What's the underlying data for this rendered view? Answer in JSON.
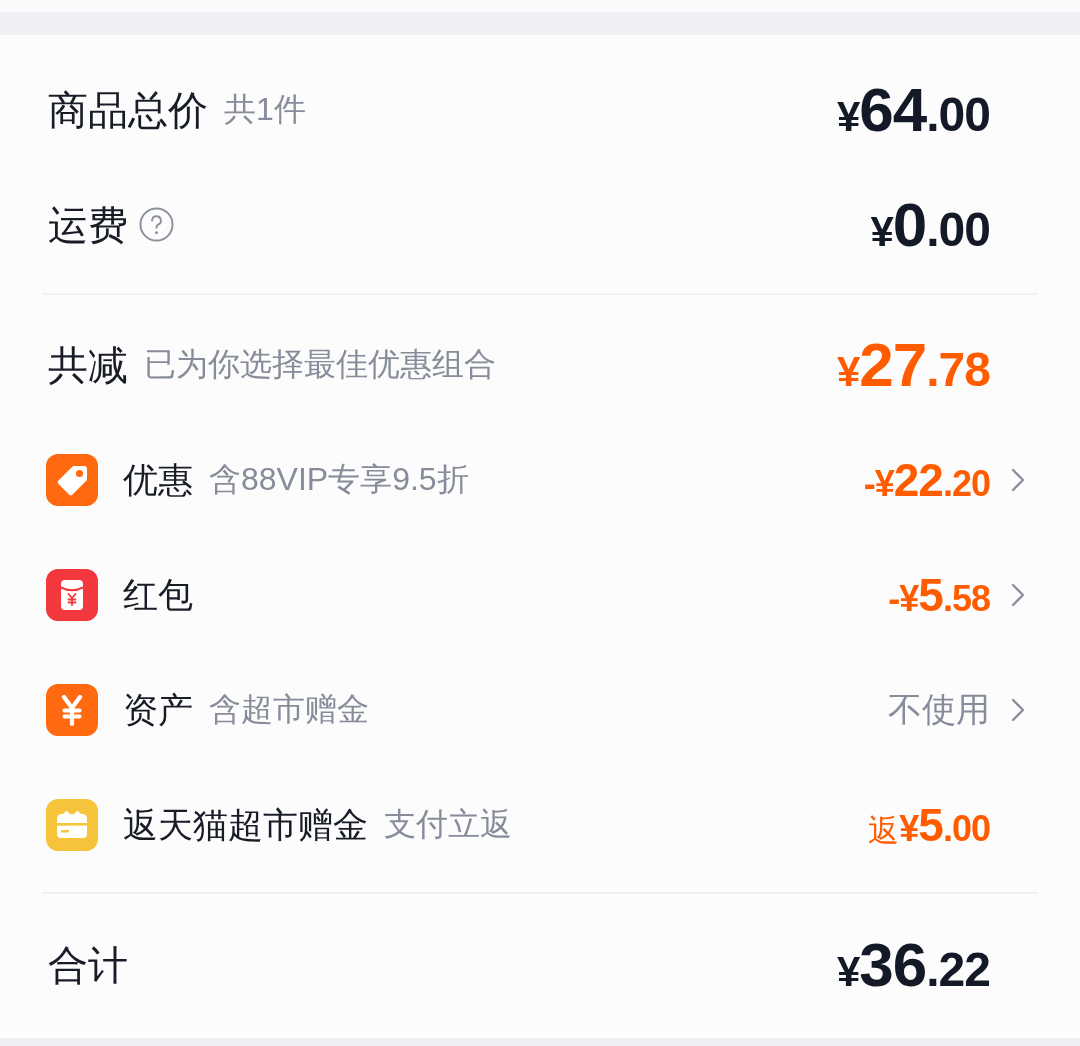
{
  "price_rows": [
    {
      "label": "商品总价",
      "note": "共1件",
      "help": false,
      "amount": "¥64.00"
    },
    {
      "label": "运费",
      "help": true,
      "amount": "¥0.00"
    }
  ],
  "discount": {
    "label": "共减",
    "note": "已为你选择最佳优惠组合",
    "amount": "¥27.78"
  },
  "items": [
    {
      "label": "优惠",
      "note": "含88VIP专享9.5折",
      "kind": "amount",
      "value": "-¥22.20",
      "chevron": true
    },
    {
      "label": "红包",
      "kind": "amount",
      "value": "-¥5.58",
      "chevron": true
    },
    {
      "label": "资产",
      "note": "含超市赠金",
      "kind": "text",
      "value": "不使用",
      "chevron": true
    },
    {
      "label": "返天猫超市赠金",
      "note": "支付立返",
      "kind": "amount",
      "prefix": "返",
      "value": "¥5.00",
      "chevron": false
    }
  ],
  "total": {
    "label": "合计",
    "amount": "¥36.22"
  }
}
